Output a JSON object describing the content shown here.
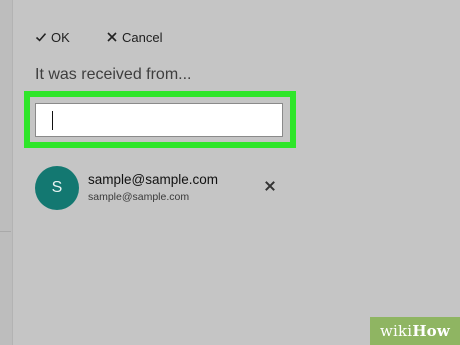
{
  "toolbar": {
    "ok_label": "OK",
    "cancel_label": "Cancel",
    "ok_icon": "check-icon",
    "cancel_icon": "close-icon"
  },
  "form": {
    "heading": "It was received from...",
    "input_value": ""
  },
  "contact": {
    "initial": "S",
    "name": "sample@sample.com",
    "email": "sample@sample.com",
    "avatar_color": "#137871",
    "remove_icon": "close-icon"
  },
  "highlight_color": "#2fe62a",
  "watermark": {
    "prefix": "wiki",
    "suffix": "How"
  }
}
